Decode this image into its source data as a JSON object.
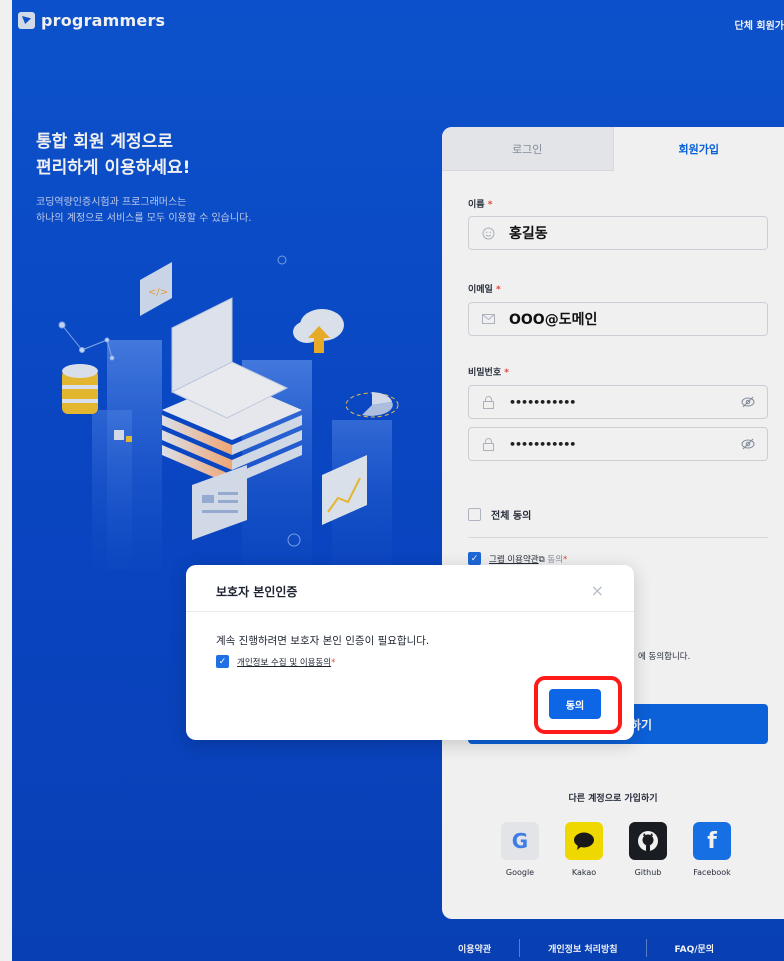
{
  "header": {
    "logo_text": "programmers",
    "group_signup": "단체 회원가"
  },
  "hero": {
    "title_line1": "통합 회원 계정으로",
    "title_line2": "편리하게 이용하세요!",
    "sub_line1": "코딩역량인증시험과 프로그래머스는",
    "sub_line2": "하나의 계정으로 서비스를 모두 이용할 수 있습니다."
  },
  "tabs": {
    "login": "로그인",
    "signup": "회원가입"
  },
  "form": {
    "name_label": "이름",
    "name_value": "홍길동",
    "email_label": "이메일",
    "email_value": "OOO@도메인",
    "password_label": "비밀번호",
    "password_value": "•••••••••••",
    "password_confirm_value": "•••••••••••",
    "required_mark": "*",
    "agree_all": "전체 동의",
    "terms_link": "그렙 이용약관",
    "terms_suffix": "동의",
    "agree_tail": "에 동의합니다.",
    "submit_fragment": "하기"
  },
  "social": {
    "title": "다른 계정으로 가입하기",
    "items": [
      {
        "label": "Google",
        "icon": "google-icon"
      },
      {
        "label": "Kakao",
        "icon": "kakao-icon"
      },
      {
        "label": "Github",
        "icon": "github-icon"
      },
      {
        "label": "Facebook",
        "icon": "facebook-icon"
      }
    ]
  },
  "footer": {
    "terms": "이용약관",
    "privacy": "개인정보 처리방침",
    "faq": "FAQ/문의"
  },
  "modal": {
    "title": "보호자 본인인증",
    "close": "×",
    "message": "계속 진행하려면 보호자 본인 인증이 필요합니다.",
    "checkbox_label": "개인정보 수집 및 이용동의",
    "required_mark": "*",
    "agree_button": "동의"
  },
  "colors": {
    "brand_blue": "#0d57d8",
    "primary_button": "#0d66e6",
    "highlight": "#ff1a1a",
    "kakao": "#fee500",
    "facebook": "#1877f2"
  }
}
